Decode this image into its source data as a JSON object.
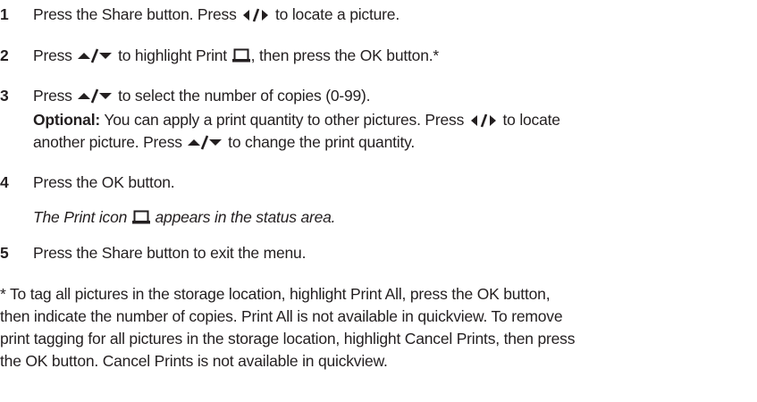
{
  "steps": [
    {
      "num": "1",
      "a": "Press the Share button. Press",
      "b": "to locate a picture."
    },
    {
      "num": "2",
      "a": "Press",
      "b": "to highlight Print",
      "c": ", then press the OK button.*"
    },
    {
      "num": "3",
      "a": "Press",
      "b": "to select the number of copies (0-99).",
      "optional_label": "Optional:",
      "optional_a": "You can apply a print quantity to other pictures. Press",
      "optional_b": "to locate",
      "optional_c": "another picture. Press",
      "optional_d": "to change the print quantity."
    },
    {
      "num": "4",
      "a": "Press the OK button.",
      "note_a": "The Print icon",
      "note_b": "appears in the status area."
    },
    {
      "num": "5",
      "a": "Press the Share button to exit the menu."
    }
  ],
  "footnote": [
    "* To tag all pictures in the storage location, highlight Print All, press the OK button,",
    "then indicate the number of copies. Print All is not available in quickview. To remove",
    "print tagging for all pictures in the storage location, highlight Cancel Prints, then press",
    "the OK button. Cancel Prints is not available in quickview."
  ],
  "icons": [
    "left-right-arrows-icon",
    "up-down-arrows-icon",
    "print-icon"
  ],
  "colors": {
    "text": "#231f20"
  }
}
